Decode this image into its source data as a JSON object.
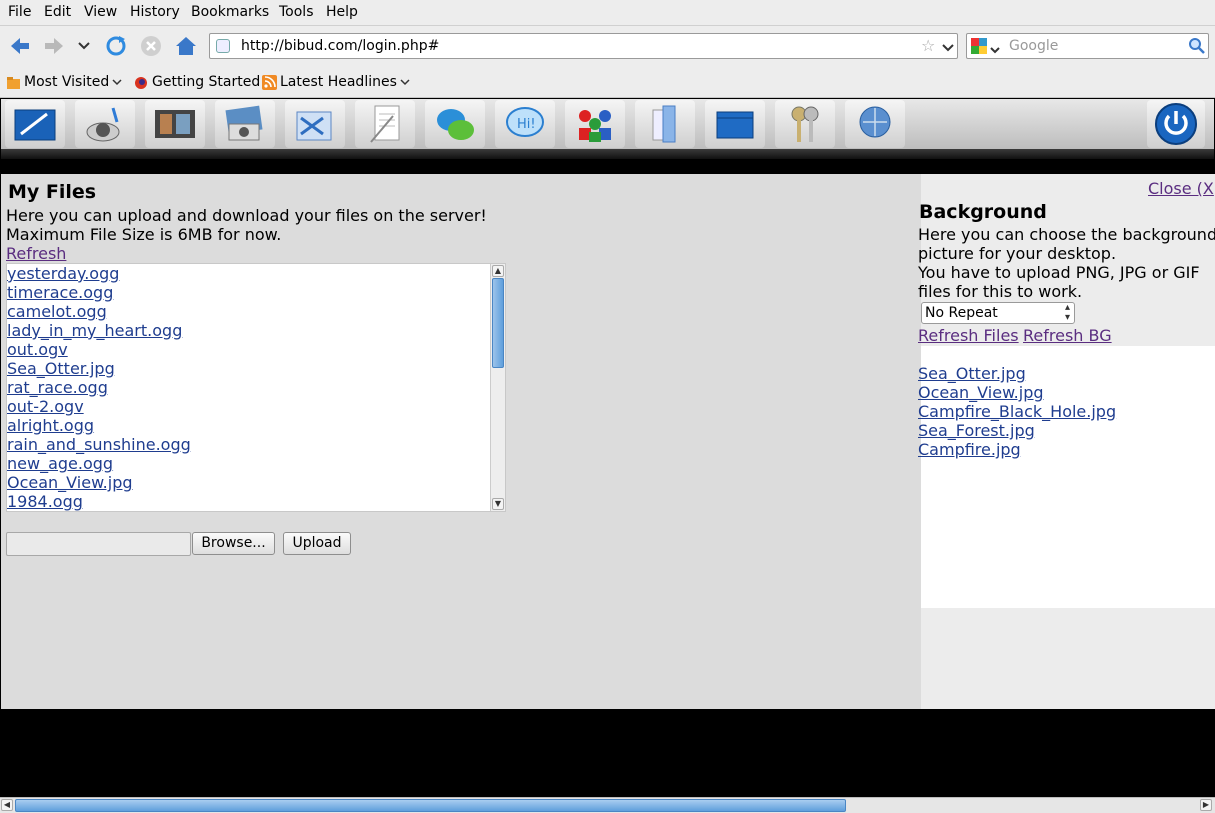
{
  "menu": [
    "File",
    "Edit",
    "View",
    "History",
    "Bookmarks",
    "Tools",
    "Help"
  ],
  "url": "http://bibud.com/login.php#",
  "search_placeholder": "Google",
  "bookmarks": [
    "Most Visited",
    "Getting Started",
    "Latest Headlines"
  ],
  "dock_icons": [
    "write-icon",
    "music-icon",
    "video-icon",
    "photos-icon",
    "mail-icon",
    "notes-icon",
    "chat-icon",
    "im-icon",
    "users-icon",
    "files-icon",
    "desktop-icon",
    "keys-icon",
    "browser-icon"
  ],
  "main": {
    "title": "My Files",
    "desc1": "Here you can upload and download your files on the server!",
    "desc2": "Maximum File Size is 6MB for now.",
    "refresh": "Refresh",
    "files": [
      "yesterday.ogg",
      "timerace.ogg",
      "camelot.ogg",
      "lady_in_my_heart.ogg",
      "out.ogv",
      "Sea_Otter.jpg",
      "rat_race.ogg",
      "out-2.ogv",
      "alright.ogg",
      "rain_and_sunshine.ogg",
      "new_age.ogg",
      "Ocean_View.jpg",
      "1984.ogg"
    ],
    "browse_label": "Browse...",
    "upload_label": "Upload"
  },
  "side": {
    "close": "Close (X",
    "title": "Background",
    "desc1": "Here you can choose the background",
    "desc2": "picture for your desktop.",
    "desc3": "You have to upload PNG, JPG or GIF",
    "desc4": "files for this to work.",
    "select_value": "No Repeat",
    "refresh_files": "Refresh Files",
    "refresh_bg": "Refresh BG",
    "bg_files": [
      "Sea_Otter.jpg",
      "Ocean_View.jpg",
      "Campfire_Black_Hole.jpg",
      "Sea_Forest.jpg",
      "Campfire.jpg"
    ]
  }
}
